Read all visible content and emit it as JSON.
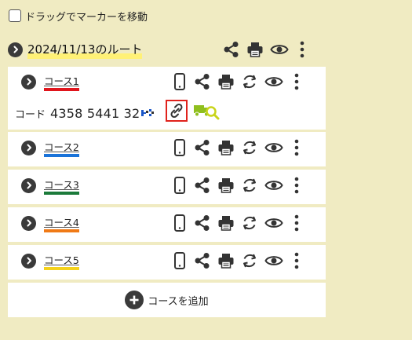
{
  "drag_toggle": {
    "label": "ドラッグでマーカーを移動",
    "checked": false
  },
  "route": {
    "title": "2024/11/13のルート"
  },
  "courses": [
    {
      "name": "コース1",
      "color": "#e0151c",
      "code_label": "コード",
      "code": "4358 5441 32"
    },
    {
      "name": "コース2",
      "color": "#1a73d9"
    },
    {
      "name": "コース3",
      "color": "#1b7a3a"
    },
    {
      "name": "コース4",
      "color": "#f07a16"
    },
    {
      "name": "コース5",
      "color": "#f4d11a"
    }
  ],
  "add_course": {
    "label": "コースを追加"
  },
  "icons": [
    "chevron-right-icon",
    "smartphone-icon",
    "share-icon",
    "print-icon",
    "refresh-icon",
    "eye-icon",
    "more-vert-icon",
    "link-icon",
    "truck-search-icon",
    "plus-icon"
  ]
}
